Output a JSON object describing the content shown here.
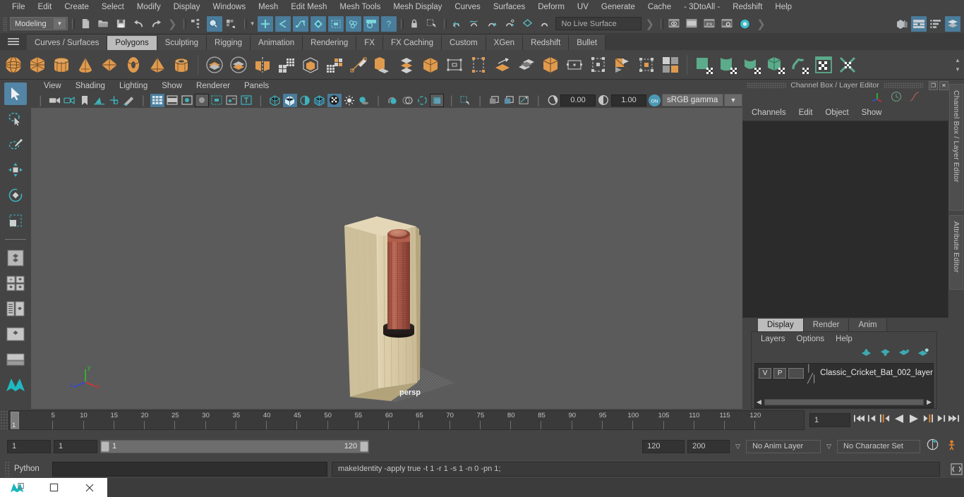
{
  "menubar": {
    "items": [
      "File",
      "Edit",
      "Create",
      "Select",
      "Modify",
      "Display",
      "Windows",
      "Mesh",
      "Edit Mesh",
      "Mesh Tools",
      "Mesh Display",
      "Curves",
      "Surfaces",
      "Deform",
      "UV",
      "Generate",
      "Cache",
      "- 3DtoAll -",
      "Redshift",
      "Help"
    ]
  },
  "statusline": {
    "menuset": "Modeling",
    "live_surface": "No Live Surface",
    "icons": [
      "new-scene-icon",
      "open-scene-icon",
      "save-scene-icon",
      "undo-icon",
      "redo-icon",
      "select-by-hierarchy-icon",
      "select-by-object-icon",
      "select-by-component-icon",
      "snap-to-grid-icon",
      "snap-to-curve-icon",
      "snap-to-point-icon",
      "snap-to-projected-center-icon",
      "snap-to-view-plane-icon",
      "make-live-icon",
      "lock-icon",
      "select-tool-icon",
      "render-view-icon",
      "render-region-icon",
      "ipr-render-icon",
      "render-settings-icon",
      "hypershade-icon",
      "show-hide-modeling-toolkit-icon",
      "show-hide-attribute-editor-icon",
      "show-hide-tool-settings-icon",
      "show-hide-channel-box-icon"
    ]
  },
  "shelf": {
    "tabs": [
      "Curves / Surfaces",
      "Polygons",
      "Sculpting",
      "Rigging",
      "Animation",
      "Rendering",
      "FX",
      "FX Caching",
      "Custom",
      "XGen",
      "Redshift",
      "Bullet"
    ],
    "active_tab": "Polygons",
    "icons": [
      "poly-sphere-icon",
      "poly-cube-icon",
      "poly-cylinder-icon",
      "poly-cone-icon",
      "poly-plane-icon",
      "poly-torus-icon",
      "poly-pyramid-icon",
      "poly-pipe-icon",
      "combine-icon",
      "separate-icon",
      "mirror-icon",
      "smooth-icon",
      "booleans-icon",
      "multi-cut-icon",
      "extrude-icon",
      "bevel-icon",
      "bridge-icon",
      "append-polygon-icon",
      "target-weld-icon",
      "quad-draw-icon",
      "transfer-attributes-icon",
      "uv-editor-icon",
      "planar-mapping-icon",
      "cylindrical-mapping-icon",
      "spherical-mapping-icon",
      "automatic-mapping-icon",
      "uv-layout-icon",
      "uv-snapshot-icon",
      "unfold-uv-icon"
    ]
  },
  "toolbox": {
    "tools": [
      "select-tool",
      "lasso-select-tool",
      "paint-select-tool",
      "move-tool",
      "rotate-tool",
      "scale-tool",
      "last-tool",
      "single-perspective-view",
      "four-view-layout",
      "persp-outliner-layout",
      "persp-graph-layout",
      "hypershade-persp-layout",
      "single-perspective-layout"
    ]
  },
  "viewport": {
    "menus": [
      "View",
      "Shading",
      "Lighting",
      "Show",
      "Renderer",
      "Panels"
    ],
    "exposure": "0.00",
    "gamma": "1.00",
    "color_management": "sRGB gamma",
    "camera_label": "persp",
    "axis": {
      "x": "x",
      "y": "y",
      "z": "z"
    },
    "toolbar_icons": [
      "select-camera-icon",
      "camera-attributes-icon",
      "bookmark-icon",
      "image-plane-icon",
      "twoD-pan-zoom-icon",
      "grease-pencil-icon",
      "grid-icon",
      "film-gate-icon",
      "resolution-gate-icon",
      "gate-mask-icon",
      "film-origin-icon",
      "safe-action-icon",
      "safe-title-icon",
      "wireframe-icon",
      "smooth-shade-icon",
      "flat-shade-icon",
      "shaded-wireframe-icon",
      "textured-icon",
      "lights-icon",
      "shadows-icon",
      "screen-space-ao-icon",
      "motion-blur-icon",
      "multisample-icon",
      "depth-peel-icon",
      "xray-icon",
      "xray-joints-icon",
      "xray-active-components-icon",
      "exposure-icon",
      "gamma-icon",
      "color-management-icon"
    ]
  },
  "channelbox": {
    "title": "Channel Box / Layer Editor",
    "menus": [
      "Channels",
      "Edit",
      "Object",
      "Show"
    ],
    "side_tabs": [
      "Channel Box / Layer Editor",
      "Attribute Editor"
    ],
    "header_icons": [
      "axis-gizmo-icon",
      "clock-icon",
      "curve-icon"
    ],
    "window_buttons": [
      "restore-icon",
      "close-icon"
    ]
  },
  "layer_editor": {
    "tabs": [
      "Display",
      "Render",
      "Anim"
    ],
    "active_tab": "Display",
    "menus": [
      "Layers",
      "Options",
      "Help"
    ],
    "buttons": [
      "move-layer-up-icon",
      "move-layer-down-icon",
      "create-new-layer-icon",
      "create-layer-from-selected-icon"
    ],
    "layers": [
      {
        "visibility": "V",
        "playback": "P",
        "color": "",
        "name": "Classic_Cricket_Bat_002_layer"
      }
    ]
  },
  "timeslider": {
    "current_frame": "1",
    "frame_field": "1",
    "ticks": [
      5,
      10,
      15,
      20,
      25,
      30,
      35,
      40,
      45,
      50,
      55,
      60,
      65,
      70,
      75,
      80,
      85,
      90,
      95,
      100,
      105,
      110,
      115,
      120
    ],
    "playback_buttons": [
      "go-to-start-icon",
      "step-back-frame-icon",
      "step-back-key-icon",
      "play-backwards-icon",
      "play-forwards-icon",
      "step-forward-key-icon",
      "step-forward-frame-icon",
      "go-to-end-icon"
    ]
  },
  "rangeslider": {
    "start_field": "1",
    "start_field2": "1",
    "range_start": "1",
    "range_end": "120",
    "end_field": "120",
    "playback_end": "200",
    "anim_layer": "No Anim Layer",
    "character_set": "No Character Set",
    "right_icons": [
      "auto-keyframe-icon",
      "animation-preferences-icon"
    ]
  },
  "commandline": {
    "language_label": "Python",
    "input_value": "",
    "output_value": "makeIdentity -apply true -t 1 -r 1 -s 1 -n 0 -pn 1;",
    "script_editor_icon": "script-editor-icon"
  },
  "taskbar": {
    "buttons": [
      "maya-app-icon",
      "maximize-icon",
      "close-icon"
    ]
  },
  "model": {
    "name": "Classic Cricket Bat",
    "blade_color": "#d8cba6",
    "handle_color": "#b05a4a",
    "collar_color": "#241c1a"
  },
  "colors": {
    "accent_blue": "#4a7c9b",
    "shelf_orange": "#e09a4e",
    "shelf_green": "#5cab8b",
    "panel_bg": "#444444",
    "viewport_bg": "#5b5b5b"
  }
}
